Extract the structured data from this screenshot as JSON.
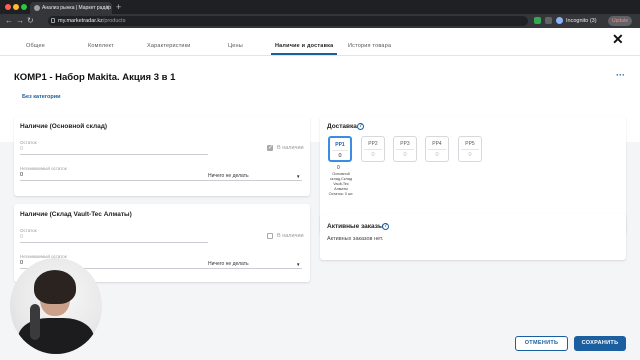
{
  "browser": {
    "tab_title": "Анализ рынка | Маркет радар",
    "new_tab": "+",
    "url_domain": "my.marketradar.kz",
    "url_path": "/products",
    "incognito_label": "Incognito (3)",
    "update_label": "Update"
  },
  "nav": {
    "tabs": [
      {
        "label": "Общее"
      },
      {
        "label": "Комплект"
      },
      {
        "label": "Характеристики"
      },
      {
        "label": "Цены"
      },
      {
        "label": "Наличие и доставка"
      },
      {
        "label": "История товара"
      }
    ],
    "active_index": 4,
    "close_glyph": "✕"
  },
  "product": {
    "title": "КОМР1 - Набор Makita. Акция 3 в 1",
    "category": "Без категории",
    "menu_glyph": "···"
  },
  "stock_main": {
    "title": "Наличие (Основной склад)",
    "remainder_label": "Остаток",
    "remainder_value": "0",
    "in_stock_label": "В наличии",
    "in_stock_checked": true,
    "min_label": "Неснижаемый остаток",
    "min_value": "0",
    "action_value": "Ничего не делать"
  },
  "stock_almaty": {
    "title": "Наличие (Склад Vault-Tec Алматы)",
    "remainder_label": "Остаток",
    "remainder_value": "0",
    "in_stock_label": "В наличии",
    "in_stock_checked": false,
    "min_label": "Неснижаемый остаток",
    "min_value": "0",
    "action_value": "Ничего не делать"
  },
  "delivery": {
    "title": "Доставка",
    "warehouses": [
      {
        "name": "PP1",
        "value": "0",
        "active": true
      },
      {
        "name": "PP2",
        "value": "0",
        "active": false
      },
      {
        "name": "PP3",
        "value": "0",
        "active": false
      },
      {
        "name": "PP4",
        "value": "0",
        "active": false
      },
      {
        "name": "PP5",
        "value": "0",
        "active": false
      }
    ],
    "note_zero": "0",
    "note_lines": [
      "Основной",
      "склад,Склад",
      "Vault-Tec",
      "Алматы"
    ],
    "note_total": "Остаток: 0 шт."
  },
  "orders": {
    "title": "Активные заказы",
    "empty_text": "Активных заказов нет."
  },
  "footer": {
    "cancel_label": "ОТМЕНИТЬ",
    "save_label": "СОХРАНИТЬ"
  },
  "colors": {
    "accent": "#1b5fa0",
    "active_border": "#3a8de0"
  },
  "icons": {
    "help": "help-circle-icon",
    "caret": "chevron-down-icon"
  }
}
